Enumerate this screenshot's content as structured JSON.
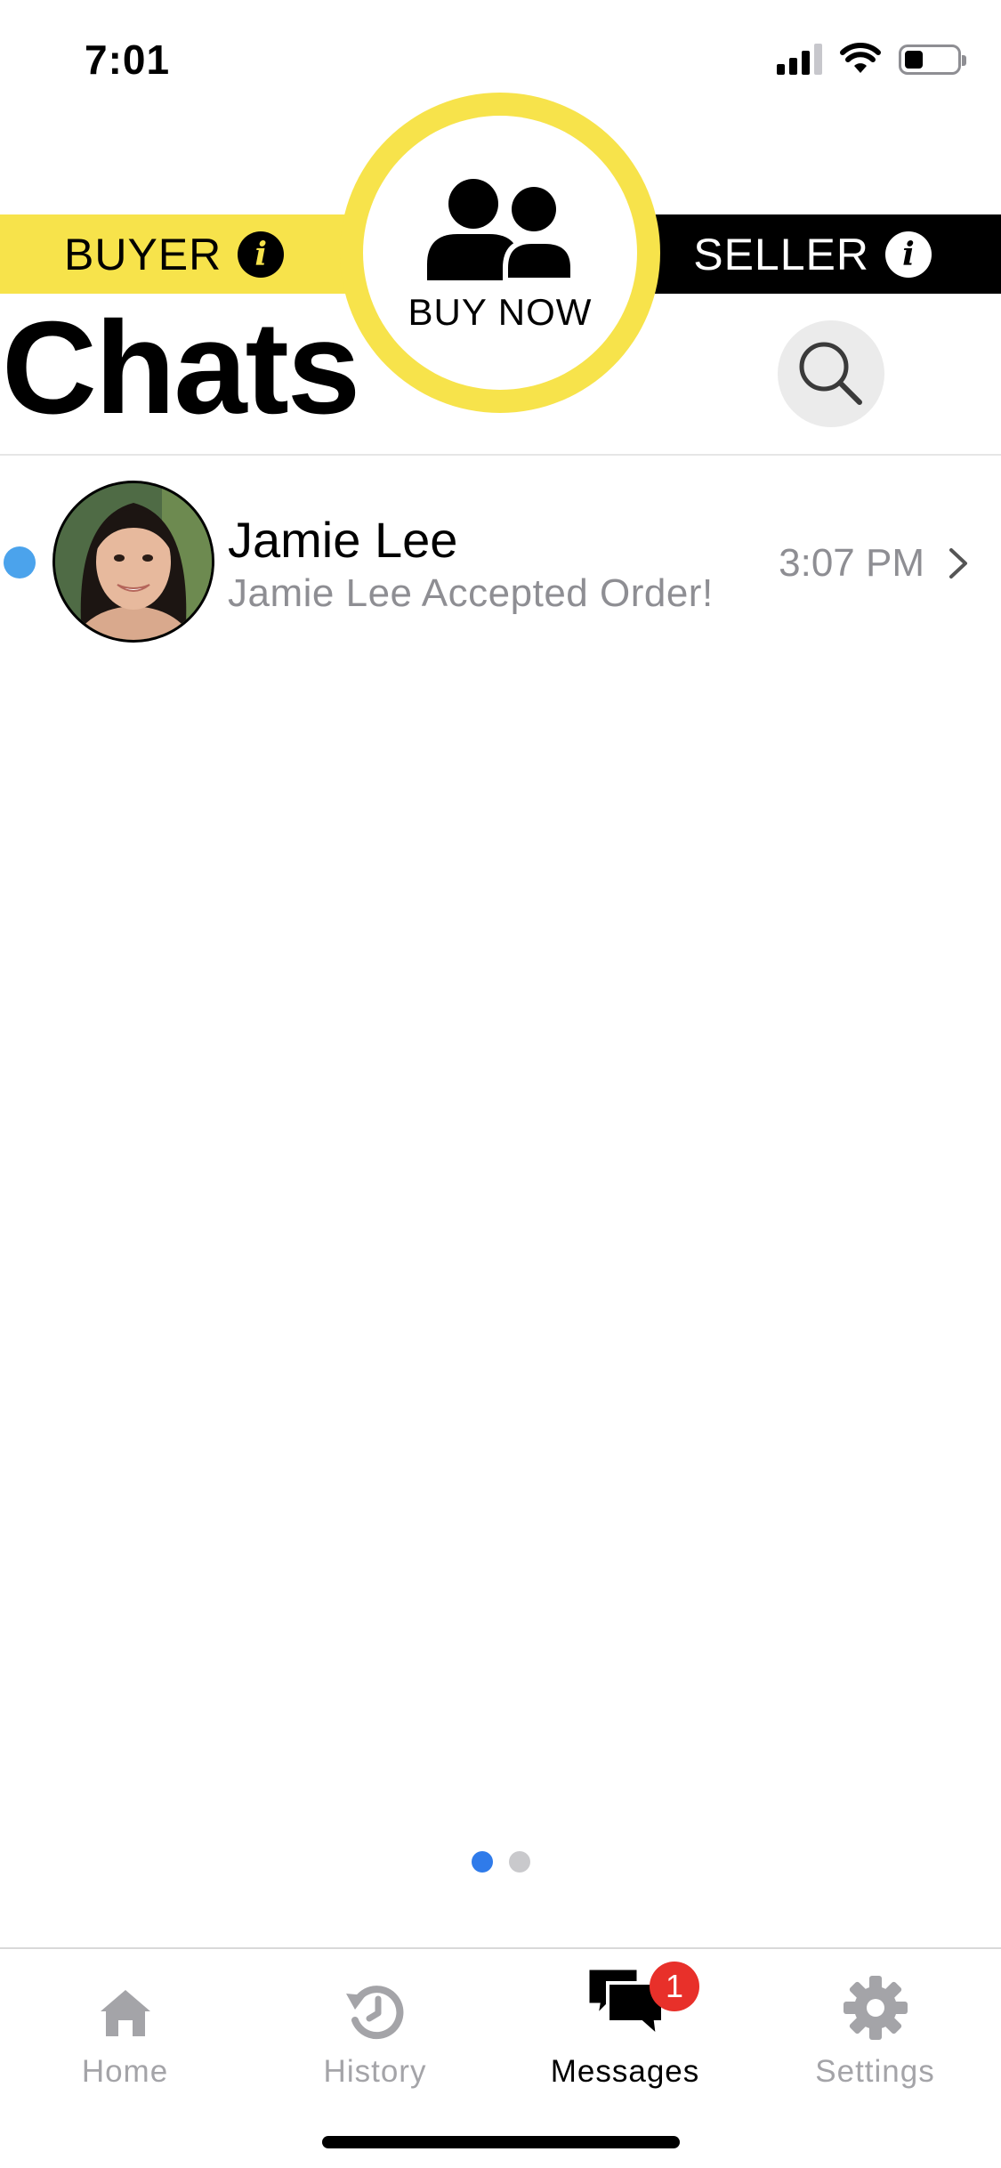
{
  "status_bar": {
    "time": "7:01",
    "signal_icon": "cellular-signal-icon",
    "wifi_icon": "wifi-icon",
    "battery_icon": "battery-icon",
    "battery_level": 0.35
  },
  "role_switch": {
    "buyer_label": "BUYER",
    "seller_label": "SELLER",
    "info_glyph": "i",
    "buy_now_label": "BUY NOW",
    "buy_now_icon": "users-icon"
  },
  "page": {
    "title": "Chats",
    "search_icon": "search-icon"
  },
  "chats": [
    {
      "name": "Jamie Lee",
      "preview": "Jamie Lee Accepted Order!",
      "time": "3:07 PM",
      "unread": true
    }
  ],
  "pager": {
    "count": 2,
    "active_index": 0
  },
  "tab_bar": {
    "tabs": [
      {
        "label": "Home",
        "icon": "home-icon",
        "active": false
      },
      {
        "label": "History",
        "icon": "history-icon",
        "active": false
      },
      {
        "label": "Messages",
        "icon": "messages-icon",
        "active": true,
        "badge": "1"
      },
      {
        "label": "Settings",
        "icon": "gear-icon",
        "active": false
      }
    ]
  },
  "colors": {
    "accent_yellow": "#f7e34b",
    "unread_blue": "#4ba3ec",
    "badge_red": "#e8302a",
    "pager_active": "#2f7bea",
    "inactive_gray": "#a4a4a8"
  }
}
